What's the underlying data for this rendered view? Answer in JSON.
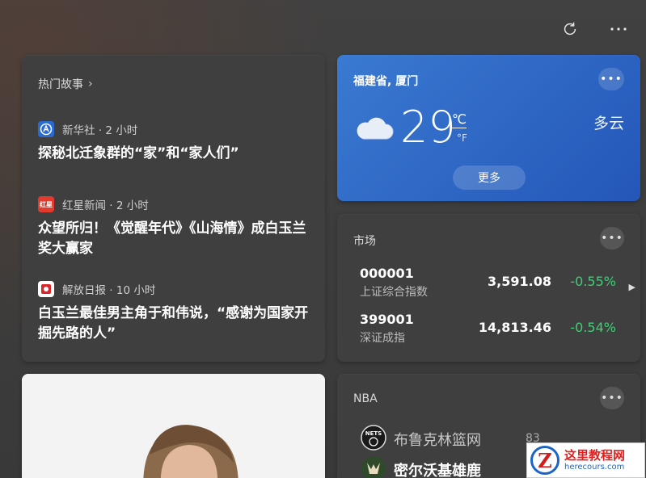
{
  "top_stories": {
    "heading": "热门故事",
    "items": [
      {
        "source": "新华社 · 2 小时",
        "logo_text": "A",
        "logo_color": "#2a6bd1",
        "headline": "探秘北迁象群的“家”和“家人们”"
      },
      {
        "source": "红星新闻 · 2 小时",
        "logo_text": "红星",
        "logo_color": "#e23b2e",
        "headline": "众望所归！《觉醒年代》《山海情》成白玉兰奖大赢家"
      },
      {
        "source": "解放日报 · 10 小时",
        "logo_text": "解",
        "logo_color": "#d9262b",
        "headline": "白玉兰最佳男主角于和伟说，“感谢为国家开掘先路的人”"
      }
    ]
  },
  "weather": {
    "location": "福建省, 厦门",
    "temperature": "29",
    "unit_c": "℃",
    "unit_f": "°F",
    "condition": "多云",
    "more_button": "更多",
    "icon": "cloud-icon"
  },
  "market": {
    "title": "市场",
    "rows": [
      {
        "code": "000001",
        "name": "上证综合指数",
        "value": "3,591.08",
        "change": "-0.55%"
      },
      {
        "code": "399001",
        "name": "深证成指",
        "value": "14,813.46",
        "change": "-0.54%"
      }
    ]
  },
  "nba": {
    "title": "NBA",
    "teams": [
      {
        "name": "布鲁克林篮网",
        "score": "83",
        "logo": "nets-logo-icon",
        "logo_text": "NETS"
      },
      {
        "name": "密尔沃基雄鹿",
        "score": "",
        "logo": "bucks-logo-icon",
        "logo_text": "B"
      }
    ]
  },
  "watermark": {
    "title": "这里教程网",
    "url": "herecours.com",
    "letter": "Z"
  },
  "colors": {
    "accent_blue": "#2e6cc9",
    "negative_change": "#3fcf76"
  }
}
